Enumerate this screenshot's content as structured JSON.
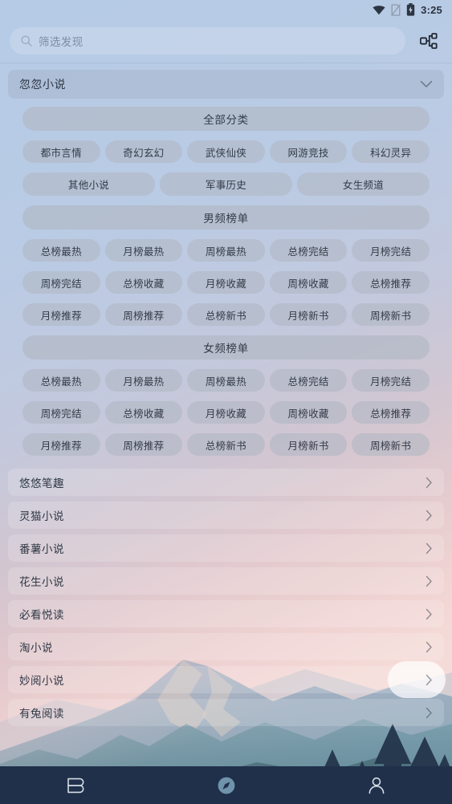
{
  "statusbar": {
    "time": "3:25",
    "icons": [
      "wifi-icon",
      "sim-card-off-icon",
      "battery-charging-icon"
    ]
  },
  "header": {
    "search_placeholder": "筛选发现",
    "search_value": "",
    "search_icon": "search-icon",
    "filter_icon": "sitemap-filter-icon"
  },
  "expanded_source": {
    "name": "忽忽小说",
    "chevron": "chevron-down-icon",
    "groups": [
      {
        "section_label": "全部分类",
        "rows": [
          [
            "都市言情",
            "奇幻玄幻",
            "武侠仙侠",
            "网游竞技",
            "科幻灵异"
          ],
          [
            "其他小说",
            "军事历史",
            "女生频道"
          ]
        ]
      },
      {
        "section_label": "男频榜单",
        "rows": [
          [
            "总榜最热",
            "月榜最热",
            "周榜最热",
            "总榜完结",
            "月榜完结"
          ],
          [
            "周榜完结",
            "总榜收藏",
            "月榜收藏",
            "周榜收藏",
            "总榜推荐"
          ],
          [
            "月榜推荐",
            "周榜推荐",
            "总榜新书",
            "月榜新书",
            "周榜新书"
          ]
        ]
      },
      {
        "section_label": "女频榜单",
        "rows": [
          [
            "总榜最热",
            "月榜最热",
            "周榜最热",
            "总榜完结",
            "月榜完结"
          ],
          [
            "周榜完结",
            "总榜收藏",
            "月榜收藏",
            "周榜收藏",
            "总榜推荐"
          ],
          [
            "月榜推荐",
            "周榜推荐",
            "总榜新书",
            "月榜新书",
            "周榜新书"
          ]
        ]
      }
    ]
  },
  "source_list": [
    {
      "name": "悠悠笔趣",
      "pressed": false
    },
    {
      "name": "灵猫小说",
      "pressed": false
    },
    {
      "name": "番薯小说",
      "pressed": false
    },
    {
      "name": "花生小说",
      "pressed": false
    },
    {
      "name": "必看悦读",
      "pressed": false
    },
    {
      "name": "淘小说",
      "pressed": false
    },
    {
      "name": "妙阅小说",
      "pressed": true
    },
    {
      "name": "有兔阅读",
      "pressed": false
    }
  ],
  "bottomnav": {
    "items": [
      {
        "icon": "bookshelf-icon",
        "active": false
      },
      {
        "icon": "compass-discover-icon",
        "active": true
      },
      {
        "icon": "person-profile-icon",
        "active": false
      }
    ],
    "background": "#20304a",
    "active_color": "#6f93ab",
    "inactive_color": "#d5dde6"
  },
  "theme": {
    "page_bg_top": "#b6cbe6",
    "page_bg_bottom": "#e8cdcd",
    "chip_bg": "rgba(176,183,194,0.58)",
    "text_primary": "#2f3845"
  }
}
